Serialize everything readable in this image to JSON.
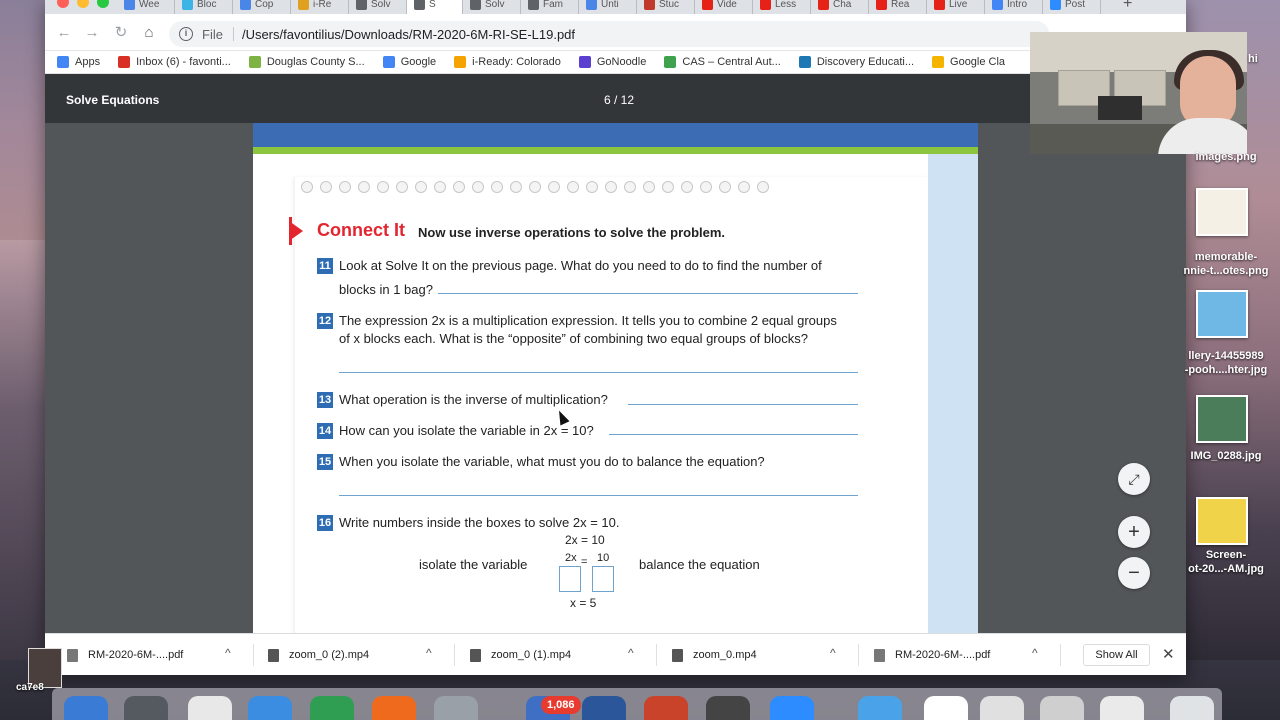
{
  "browser": {
    "tabs": [
      {
        "label": "Wee",
        "color": "#4a86e8",
        "active": false
      },
      {
        "label": "Bloc",
        "color": "#3cb4e6",
        "active": false
      },
      {
        "label": "Cop",
        "color": "#4a86e8",
        "active": false
      },
      {
        "label": "i-Re",
        "color": "#e0a020",
        "active": false
      },
      {
        "label": "Solv",
        "color": "#5f6368",
        "active": false
      },
      {
        "label": "S",
        "color": "#5f6368",
        "active": true
      },
      {
        "label": "Solv",
        "color": "#5f6368",
        "active": false
      },
      {
        "label": "Fam",
        "color": "#5f6368",
        "active": false
      },
      {
        "label": "Unti",
        "color": "#4a86e8",
        "active": false
      },
      {
        "label": "Stuc",
        "color": "#c0392b",
        "active": false
      },
      {
        "label": "Vide",
        "color": "#e62117",
        "active": false
      },
      {
        "label": "Less",
        "color": "#e62117",
        "active": false
      },
      {
        "label": "Cha",
        "color": "#e62117",
        "active": false
      },
      {
        "label": "Rea",
        "color": "#e62117",
        "active": false
      },
      {
        "label": "Live",
        "color": "#e62117",
        "active": false
      },
      {
        "label": "Intro",
        "color": "#4285f4",
        "active": false
      },
      {
        "label": "Post",
        "color": "#2d8cff",
        "active": false
      }
    ],
    "new_tab_glyph": "+",
    "address": {
      "scheme_label": "File",
      "url": "/Users/favontilius/Downloads/RM-2020-6M-RI-SE-L19.pdf"
    },
    "bookmarks": [
      {
        "label": "Apps",
        "color": "#4285f4"
      },
      {
        "label": "Inbox (6) - favonti...",
        "color": "#d93025"
      },
      {
        "label": "Douglas County S...",
        "color": "#7cb342"
      },
      {
        "label": "Google",
        "color": "#4285f4"
      },
      {
        "label": "i-Ready: Colorado",
        "color": "#f4a300"
      },
      {
        "label": "GoNoodle",
        "color": "#5b3fd1"
      },
      {
        "label": "CAS – Central Aut...",
        "color": "#3fa34d"
      },
      {
        "label": "Discovery Educati...",
        "color": "#1f77b4"
      },
      {
        "label": "Google Cla",
        "color": "#f4b400"
      }
    ]
  },
  "pdf": {
    "title": "Solve Equations",
    "page_indicator": "6 / 12",
    "heading": "Connect It",
    "subheading": "Now use inverse operations to solve the problem.",
    "questions": [
      {
        "num": "11",
        "lines": [
          "Look at Solve It on the previous page. What do you need to do to find the number of",
          "blocks in 1 bag?"
        ]
      },
      {
        "num": "12",
        "lines": [
          "The expression 2x is a multiplication expression. It tells you to combine 2 equal groups",
          "of x blocks each. What is the “opposite” of combining two equal groups of blocks?"
        ]
      },
      {
        "num": "13",
        "lines": [
          "What operation is the inverse of multiplication?"
        ]
      },
      {
        "num": "14",
        "lines": [
          "How can you isolate the variable in 2x = 10?"
        ]
      },
      {
        "num": "15",
        "lines": [
          "When you isolate the variable, what must you do to balance the equation?"
        ]
      },
      {
        "num": "16",
        "lines": [
          "Write numbers inside the boxes to solve 2x = 10."
        ]
      }
    ],
    "equation": {
      "top": "2x = 10",
      "left_num": "2x",
      "equals": "=",
      "right_num": "10",
      "bottom": "x = 5",
      "left_label": "isolate the variable",
      "right_label": "balance the equation"
    },
    "controls": {
      "fit": "⤢",
      "zoom_in": "+",
      "zoom_out": "−"
    }
  },
  "downloads": {
    "items": [
      {
        "name": "RM-2020-6M-....pdf",
        "color": "#777777"
      },
      {
        "name": "zoom_0 (2).mp4",
        "color": "#555555"
      },
      {
        "name": "zoom_0 (1).mp4",
        "color": "#555555"
      },
      {
        "name": "zoom_0.mp4",
        "color": "#555555"
      },
      {
        "name": "RM-2020-6M-....pdf",
        "color": "#777777"
      }
    ],
    "show_all_label": "Show All",
    "close_glyph": "✕",
    "chevron_glyph": "^"
  },
  "desktop": {
    "files": [
      {
        "label_lines": [
          "images.png"
        ]
      },
      {
        "label_lines": [
          "memorable-",
          "nnie-t...otes.png"
        ]
      },
      {
        "label_lines": [
          "llery-14455989",
          "-pooh....hter.jpg"
        ]
      },
      {
        "label_lines": [
          "IMG_0288.jpg"
        ]
      },
      {
        "label_lines": [
          "Screen-",
          "ot-20...-AM.jpg"
        ]
      }
    ],
    "left_label": "ca7e8",
    "top_right_text": "hi",
    "dock_badge": "1,086"
  }
}
